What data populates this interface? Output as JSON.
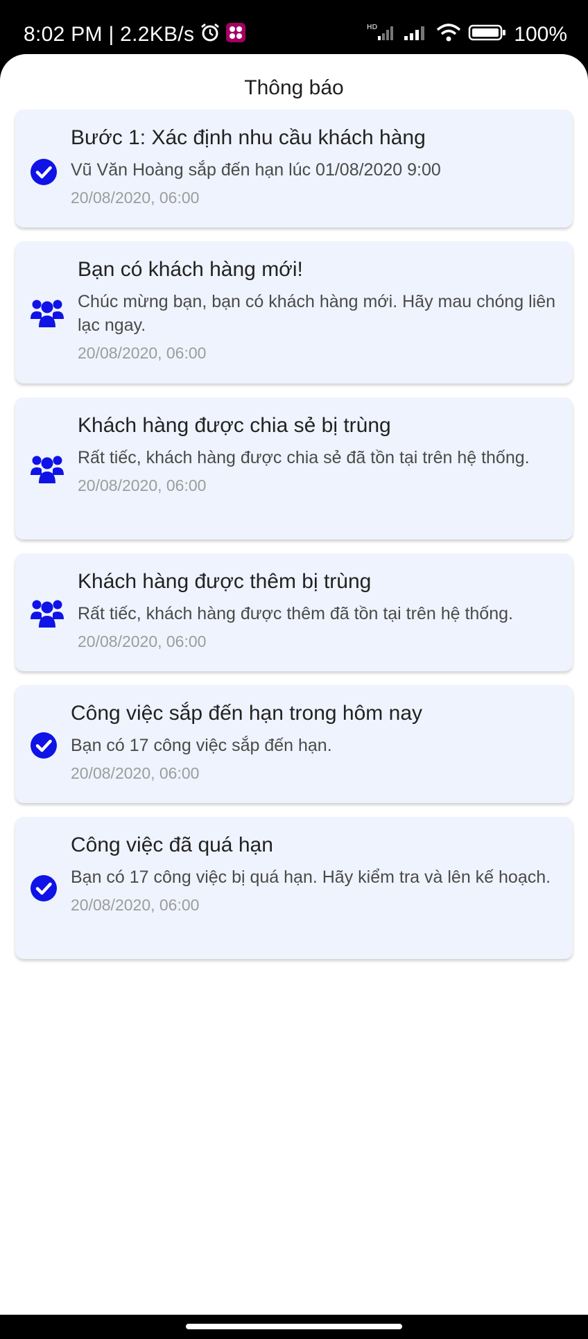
{
  "status_bar": {
    "time": "8:02 PM | 2.2KB/s",
    "battery": "100%",
    "app_badge": "momo",
    "icons": [
      "alarm-icon",
      "momo-app-icon",
      "hd-signal-icon",
      "signal-icon",
      "wifi-icon",
      "battery-icon"
    ]
  },
  "page": {
    "title": "Thông báo"
  },
  "notifications": [
    {
      "icon": "check-circle-icon",
      "title": "Bước 1: Xác định nhu cầu khách hàng",
      "message": "Vũ Văn Hoàng sắp đến hạn lúc 01/08/2020 9:00",
      "time": "20/08/2020, 06:00"
    },
    {
      "icon": "users-icon",
      "title": "Bạn có khách hàng mới!",
      "message": "Chúc mừng bạn, bạn có khách hàng mới. Hãy mau chóng liên lạc ngay.",
      "time": "20/08/2020, 06:00"
    },
    {
      "icon": "users-icon",
      "title": "Khách hàng được chia sẻ bị trùng",
      "message": "Rất tiếc, khách hàng được chia sẻ đã tồn tại trên hệ thống.",
      "time": "20/08/2020, 06:00"
    },
    {
      "icon": "users-icon",
      "title": "Khách hàng được thêm bị trùng",
      "message": "Rất tiếc, khách hàng được thêm đã tồn tại trên hệ thống.",
      "time": "20/08/2020, 06:00"
    },
    {
      "icon": "check-circle-icon",
      "title": "Công việc sắp đến hạn trong hôm nay",
      "message": "Bạn có 17 công việc sắp đến hạn.",
      "time": "20/08/2020, 06:00"
    },
    {
      "icon": "check-circle-icon",
      "title": "Công việc đã quá hạn",
      "message": "Bạn có 17 công việc bị quá hạn. Hãy kiểm tra và lên kế hoạch.",
      "time": "20/08/2020, 06:00"
    }
  ],
  "colors": {
    "accent": "#0f13e6",
    "card_bg": "#eff3fd"
  }
}
